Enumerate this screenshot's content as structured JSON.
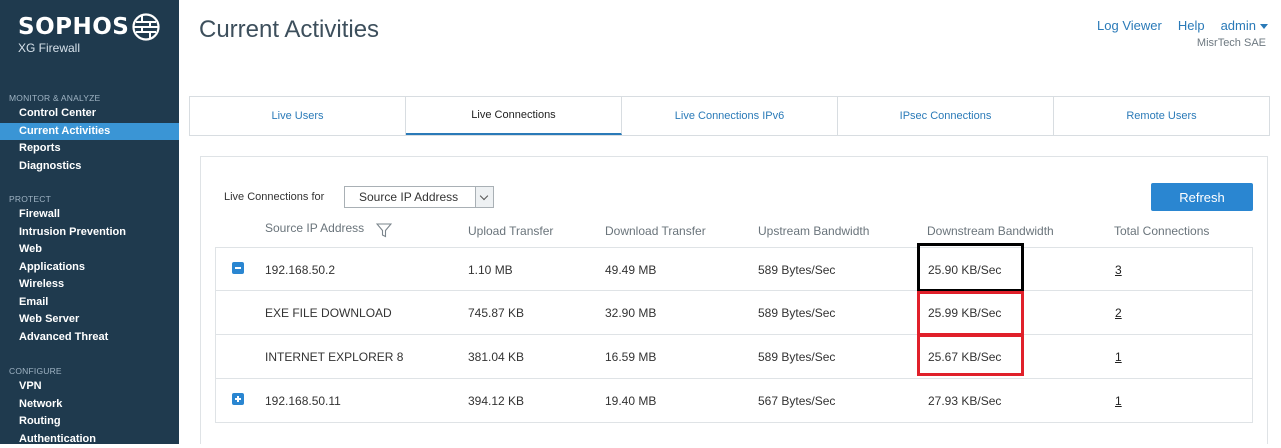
{
  "sidebar": {
    "brand": "SOPHOS",
    "product": "XG Firewall",
    "sections": [
      {
        "heading": "MONITOR & ANALYZE",
        "items": [
          {
            "label": "Control Center",
            "active": false
          },
          {
            "label": "Current Activities",
            "active": true
          },
          {
            "label": "Reports",
            "active": false
          },
          {
            "label": "Diagnostics",
            "active": false
          }
        ]
      },
      {
        "heading": "PROTECT",
        "items": [
          {
            "label": "Firewall"
          },
          {
            "label": "Intrusion Prevention"
          },
          {
            "label": "Web"
          },
          {
            "label": "Applications"
          },
          {
            "label": "Wireless"
          },
          {
            "label": "Email"
          },
          {
            "label": "Web Server"
          },
          {
            "label": "Advanced Threat"
          }
        ]
      },
      {
        "heading": "CONFIGURE",
        "items": [
          {
            "label": "VPN"
          },
          {
            "label": "Network"
          },
          {
            "label": "Routing"
          },
          {
            "label": "Authentication"
          }
        ]
      }
    ]
  },
  "header": {
    "title": "Current Activities",
    "log_viewer": "Log Viewer",
    "help": "Help",
    "user": "admin",
    "company": "MisrTech SAE"
  },
  "tabs": [
    {
      "label": "Live Users",
      "active": false
    },
    {
      "label": "Live Connections",
      "active": true
    },
    {
      "label": "Live Connections IPv6",
      "active": false
    },
    {
      "label": "IPsec Connections",
      "active": false
    },
    {
      "label": "Remote Users",
      "active": false
    }
  ],
  "filter": {
    "label": "Live Connections for",
    "selected": "Source IP Address"
  },
  "refresh_label": "Refresh",
  "table": {
    "columns": [
      "Source IP Address",
      "Upload Transfer",
      "Download Transfer",
      "Upstream Bandwidth",
      "Downstream Bandwidth",
      "Total Connections"
    ],
    "rows": [
      {
        "expander": "minus",
        "source": "192.168.50.2",
        "upload": "1.10 MB",
        "download": "49.49 MB",
        "upstream": "589 Bytes/Sec",
        "downstream": "25.90 KB/Sec",
        "total": "3"
      },
      {
        "expander": "none",
        "source": "EXE FILE DOWNLOAD",
        "upload": "745.87 KB",
        "download": "32.90 MB",
        "upstream": "589 Bytes/Sec",
        "downstream": "25.99 KB/Sec",
        "total": "2"
      },
      {
        "expander": "none",
        "source": "INTERNET EXPLORER 8",
        "upload": "381.04 KB",
        "download": "16.59 MB",
        "upstream": "589 Bytes/Sec",
        "downstream": "25.67 KB/Sec",
        "total": "1"
      },
      {
        "expander": "plus",
        "source": "192.168.50.11",
        "upload": "394.12 KB",
        "download": "19.40 MB",
        "upstream": "567 Bytes/Sec",
        "downstream": "27.93 KB/Sec",
        "total": "1"
      }
    ]
  },
  "colors": {
    "sidebar_bg": "#1f3a4e",
    "accent": "#2a86d1",
    "highlight_black": "#000000",
    "highlight_red": "#e0202a"
  }
}
